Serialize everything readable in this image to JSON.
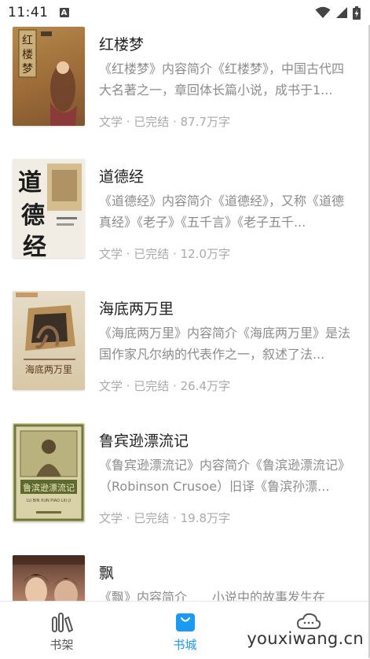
{
  "status_bar": {
    "time": "11:41",
    "notification_letter": "A"
  },
  "books": [
    {
      "title": "红楼梦",
      "description": "《红楼梦》内容简介《红楼梦》，中国古代四大名著之一，章回体长篇小说，成书于1...",
      "meta": "文学 · 已完结 · 87.7万字",
      "cover_text": "红楼梦"
    },
    {
      "title": "道德经",
      "description": "《道德经》内容简介《道德经》，又称《道德真经》《老子》《五千言》《老子五千...",
      "meta": "文学 · 已完结 · 12.0万字",
      "cover_text": "道德经"
    },
    {
      "title": "海底两万里",
      "description": "《海底两万里》内容简介《海底两万里》是法国作家凡尔纳的代表作之一，叙述了法...",
      "meta": "文学 · 已完结 · 26.4万字",
      "cover_text": "海底两万里"
    },
    {
      "title": "鲁宾逊漂流记",
      "description": "《鲁宾逊漂流记》内容简介《鲁滨逊漂流记》（Robinson Crusoe）旧译《鲁滨孙漂...",
      "meta": "文学 · 已完结 · 19.8万字",
      "cover_text": "鲁滨逊漂流记"
    },
    {
      "title": "飘",
      "description": "《飘》内容简介　　小说中的故事发生在",
      "meta": ""
    }
  ],
  "tabs": [
    {
      "label": "书架",
      "icon": "bookshelf-icon",
      "active": false
    },
    {
      "label": "书城",
      "icon": "shopping-bag-icon",
      "active": true
    },
    {
      "label": "",
      "icon": "cloud-icon",
      "active": false
    }
  ],
  "colors": {
    "accent": "#1a9af2",
    "desc_text": "#8c8c8c",
    "meta_text": "#aaaaaa"
  },
  "watermark": "youxiwang.cn"
}
